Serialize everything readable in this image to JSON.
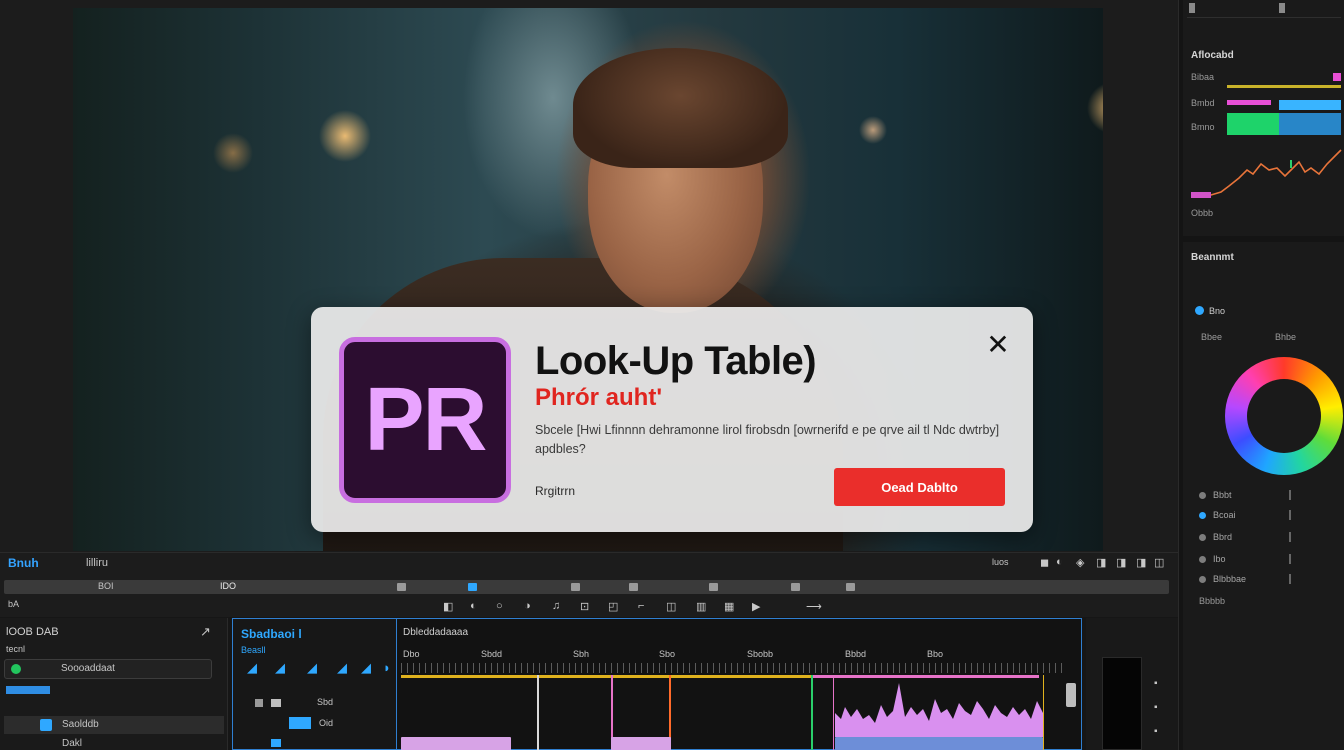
{
  "dialog": {
    "title": "Look-Up Table)",
    "subtitle": "Phrór auht'",
    "description": "Sbcele [Hwi Lfinnnn dehramonne lirol firobsdn [owrnerifd e pe qrve ail tl Ndc dwtrby] apdbles?",
    "logo_text": "PR",
    "secondary_label": "Rrgitrrn",
    "primary_label": "Oead Dablto",
    "close_glyph": "✕"
  },
  "transport": {
    "panel_name": "Bnuh",
    "sequence_label": "lilliru",
    "left_code": "BOI",
    "mid_code": "IDO",
    "right_text": "luos",
    "row2_label": "bA",
    "controls": [
      "◧",
      "◐",
      "○",
      "◑",
      "♫",
      "⊡",
      "◰",
      "⌐",
      "◫",
      "▥",
      "▦",
      "▶",
      "⟶"
    ],
    "right_controls": [
      "◼",
      "◐",
      "◈",
      "◨",
      "◨",
      "◨",
      "◫"
    ]
  },
  "project": {
    "title": "lOOB DAB",
    "subtitle": "tecnl",
    "search_value": "Soooaddaat",
    "rows": [
      "Saolddb",
      "Dakl"
    ],
    "header_icon": "↗"
  },
  "source": {
    "title": "Sbadbaoi l",
    "subtitle": "Beasll",
    "row_labels": [
      "Sbd",
      "Oid"
    ],
    "tools": [
      "◢",
      "◢",
      "◢",
      "◢",
      "◢",
      "◗"
    ]
  },
  "timeline": {
    "title": "Dbleddadaaaa",
    "ruler_labels": [
      "Dbo",
      "Sbdd",
      "Sbh",
      "Sbo",
      "Sbobb",
      "Bbbd",
      "Bbo"
    ]
  },
  "scopes": {
    "title": "Aflocabd",
    "labels": [
      "Bibaa",
      "Bmbd",
      "Bmno",
      "Obbb"
    ]
  },
  "color": {
    "title": "Beannmt",
    "tab_label": "Bno",
    "section_a": "Bbee",
    "section_b": "Bhbe",
    "params": [
      "Bbbt",
      "Bcoai",
      "Bbrd",
      "Ibo",
      "Blbbbae"
    ],
    "footer": "Bbbbb"
  },
  "colors": {
    "accent_blue": "#2fa8ff",
    "dialog_primary": "#ea2e2b",
    "logo_bg": "#2c0d30",
    "logo_border": "#c86ee0",
    "logo_text": "#e9a4ff"
  },
  "icons": {
    "close": "close-icon",
    "logo": "premiere-pro-logo"
  }
}
